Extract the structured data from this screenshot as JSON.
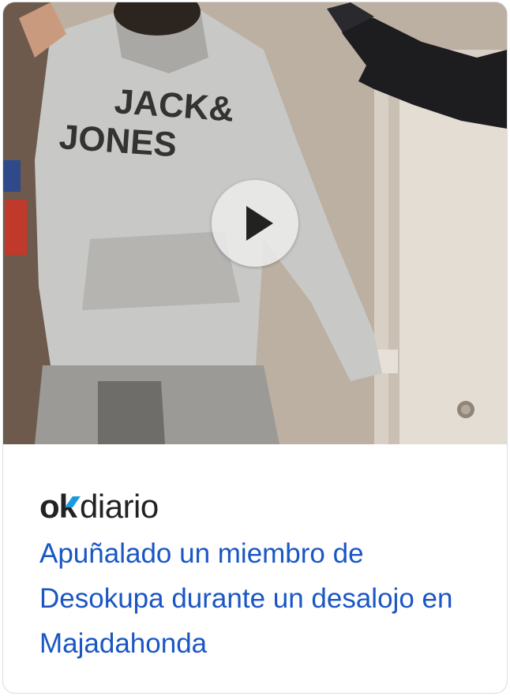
{
  "card": {
    "publisher": {
      "ok": "ok",
      "diario": "diario"
    },
    "headline": "Apuñalado un miembro de Desokupa durante un desalojo en Majadahonda"
  },
  "media": {
    "thumbnail_shirt_text_line1": "JACK&",
    "thumbnail_shirt_text_line2": "JONES",
    "play_icon": "play-icon"
  },
  "colors": {
    "headline": "#1a56c4",
    "logo_accent": "#1a9be0",
    "card_border": "#dadce0"
  }
}
